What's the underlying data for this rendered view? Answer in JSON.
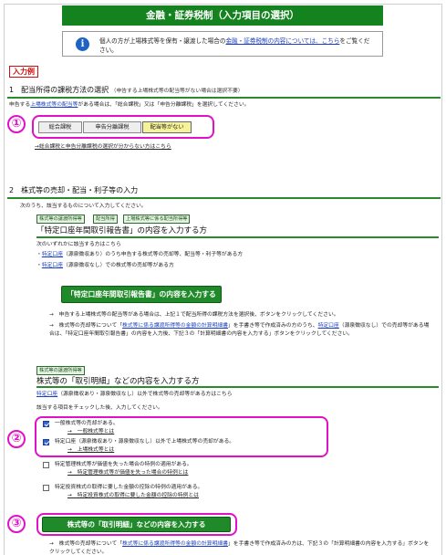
{
  "page": {
    "title": "金融・証券税制（入力項目の選択）"
  },
  "info": {
    "icon": "info-icon",
    "text_before": "個人の方が上場株式等を保有・譲渡した場合の",
    "link": "金融・証券税制の内容については、こちら",
    "text_after": "をご覧ください。"
  },
  "example_label": "入力例",
  "section1": {
    "heading": "1　配当所得の課税方法の選択",
    "subheading": "（申告する上場株式等の配当等がない場合は選択不要）",
    "desc_before": "申告する",
    "desc_link": "上場株式等の配当等",
    "desc_after": "がある場合は、「総合課税」又は「申告分離課税」を選択してください。",
    "options": [
      "総合課税",
      "申告分離課税",
      "配当等がない"
    ],
    "selected": "配当等がない",
    "help_link": "→総合課税と申告分離課税の選択が分からない方はこちら"
  },
  "section2": {
    "heading": "2　株式等の売却・配当・利子等の入力",
    "intro": "次のうち、該当するものについて入力してください。",
    "panel1": {
      "tags": [
        "株式等の譲渡所得等",
        "配当所得",
        "上場株式等に係る配当所得等"
      ],
      "title": "「特定口座年間取引報告書」の内容を入力する方",
      "lead": "次のいずれかに該当する方はこちら",
      "bullet1_link": "特定口座",
      "bullet1_text": "（源泉徴収あり）のうち申告する株式等の売却等、配当等・利子等がある方",
      "bullet2_link": "特定口座",
      "bullet2_text": "（源泉徴収なし）での株式等の売却等がある方",
      "button": "「特定口座年間取引報告書」の内容を入力する",
      "note1": "→　申告する上場株式等の配当等がある場合は、上記１で配当所得の課税方法を選択後、ボタンをクリックしてください。",
      "note2_a": "→　株式等の売却等について「",
      "note2_link": "株式等に係る譲渡所得等の金額の計算明細書",
      "note2_b": "」を手書き等で作成済みの方のうち、",
      "note2_link2": "特定口座",
      "note2_c": "（源泉徴収なし）での売却等がある場合は、「特定口座年間取引報告書」の内容を入力後、下記３の「計算明細書の内容を入力する」ボタンをクリックしてください。"
    },
    "panel2": {
      "tag": "株式等の譲渡所得等",
      "title": "株式等の「取引明細」などの内容を入力する方",
      "lead_link": "特定口座",
      "lead_text": "（源泉徴収あり・源泉徴収なし）以外で株式等の売却等がある方はこちら",
      "check_instruction": "該当する項目をチェックした後、入力してください。",
      "items": [
        {
          "label": "一般株式等の売却がある。",
          "link": "→　一般株式等とは",
          "checked": true
        },
        {
          "label": "特定口座（源泉徴収あり・源泉徴収なし）以外で上場株式等の売却がある。",
          "link": "→　上場株式等とは",
          "checked": true
        },
        {
          "label": "特定管理株式等が価値を失った場合の特例の適用がある。",
          "link": "→　特定管理株式等が価値を失った場合の特例とは",
          "checked": false
        },
        {
          "label": "特定投資株式の取得に要した金額の控除の特例の適用がある。",
          "link": "→　特定投資株式の取得に要した金額の控除の特例とは",
          "checked": false
        }
      ],
      "button": "株式等の「取引明細」などの内容を入力する",
      "footer_a": "→　株式等の売却等について「",
      "footer_link": "株式等に係る譲渡所得等の金額の計算明細書",
      "footer_b": "」を手書き等で作成済みの方は、下記３の「計算明細書の内容を入力する」ボタンをクリックしてください。"
    }
  },
  "markers": [
    "①",
    "②",
    "③"
  ],
  "colors": {
    "accent_green": "#14821f",
    "highlight_magenta": "#e011c8",
    "link_blue": "#1a3fbf",
    "selected_yellow": "#f5f29a"
  }
}
